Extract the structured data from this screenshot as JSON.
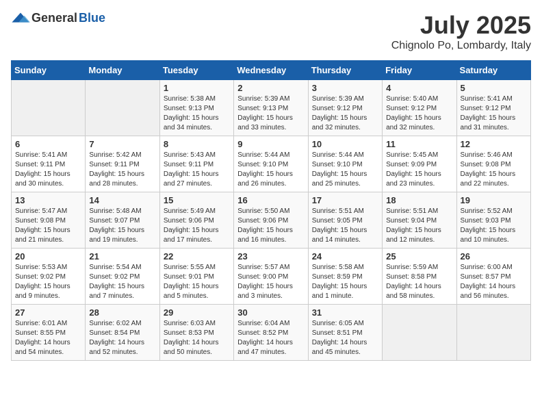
{
  "logo": {
    "general": "General",
    "blue": "Blue"
  },
  "title": "July 2025",
  "subtitle": "Chignolo Po, Lombardy, Italy",
  "headers": [
    "Sunday",
    "Monday",
    "Tuesday",
    "Wednesday",
    "Thursday",
    "Friday",
    "Saturday"
  ],
  "weeks": [
    [
      {
        "day": "",
        "info": ""
      },
      {
        "day": "",
        "info": ""
      },
      {
        "day": "1",
        "info": "Sunrise: 5:38 AM\nSunset: 9:13 PM\nDaylight: 15 hours\nand 34 minutes."
      },
      {
        "day": "2",
        "info": "Sunrise: 5:39 AM\nSunset: 9:13 PM\nDaylight: 15 hours\nand 33 minutes."
      },
      {
        "day": "3",
        "info": "Sunrise: 5:39 AM\nSunset: 9:12 PM\nDaylight: 15 hours\nand 32 minutes."
      },
      {
        "day": "4",
        "info": "Sunrise: 5:40 AM\nSunset: 9:12 PM\nDaylight: 15 hours\nand 32 minutes."
      },
      {
        "day": "5",
        "info": "Sunrise: 5:41 AM\nSunset: 9:12 PM\nDaylight: 15 hours\nand 31 minutes."
      }
    ],
    [
      {
        "day": "6",
        "info": "Sunrise: 5:41 AM\nSunset: 9:11 PM\nDaylight: 15 hours\nand 30 minutes."
      },
      {
        "day": "7",
        "info": "Sunrise: 5:42 AM\nSunset: 9:11 PM\nDaylight: 15 hours\nand 28 minutes."
      },
      {
        "day": "8",
        "info": "Sunrise: 5:43 AM\nSunset: 9:11 PM\nDaylight: 15 hours\nand 27 minutes."
      },
      {
        "day": "9",
        "info": "Sunrise: 5:44 AM\nSunset: 9:10 PM\nDaylight: 15 hours\nand 26 minutes."
      },
      {
        "day": "10",
        "info": "Sunrise: 5:44 AM\nSunset: 9:10 PM\nDaylight: 15 hours\nand 25 minutes."
      },
      {
        "day": "11",
        "info": "Sunrise: 5:45 AM\nSunset: 9:09 PM\nDaylight: 15 hours\nand 23 minutes."
      },
      {
        "day": "12",
        "info": "Sunrise: 5:46 AM\nSunset: 9:08 PM\nDaylight: 15 hours\nand 22 minutes."
      }
    ],
    [
      {
        "day": "13",
        "info": "Sunrise: 5:47 AM\nSunset: 9:08 PM\nDaylight: 15 hours\nand 21 minutes."
      },
      {
        "day": "14",
        "info": "Sunrise: 5:48 AM\nSunset: 9:07 PM\nDaylight: 15 hours\nand 19 minutes."
      },
      {
        "day": "15",
        "info": "Sunrise: 5:49 AM\nSunset: 9:06 PM\nDaylight: 15 hours\nand 17 minutes."
      },
      {
        "day": "16",
        "info": "Sunrise: 5:50 AM\nSunset: 9:06 PM\nDaylight: 15 hours\nand 16 minutes."
      },
      {
        "day": "17",
        "info": "Sunrise: 5:51 AM\nSunset: 9:05 PM\nDaylight: 15 hours\nand 14 minutes."
      },
      {
        "day": "18",
        "info": "Sunrise: 5:51 AM\nSunset: 9:04 PM\nDaylight: 15 hours\nand 12 minutes."
      },
      {
        "day": "19",
        "info": "Sunrise: 5:52 AM\nSunset: 9:03 PM\nDaylight: 15 hours\nand 10 minutes."
      }
    ],
    [
      {
        "day": "20",
        "info": "Sunrise: 5:53 AM\nSunset: 9:02 PM\nDaylight: 15 hours\nand 9 minutes."
      },
      {
        "day": "21",
        "info": "Sunrise: 5:54 AM\nSunset: 9:02 PM\nDaylight: 15 hours\nand 7 minutes."
      },
      {
        "day": "22",
        "info": "Sunrise: 5:55 AM\nSunset: 9:01 PM\nDaylight: 15 hours\nand 5 minutes."
      },
      {
        "day": "23",
        "info": "Sunrise: 5:57 AM\nSunset: 9:00 PM\nDaylight: 15 hours\nand 3 minutes."
      },
      {
        "day": "24",
        "info": "Sunrise: 5:58 AM\nSunset: 8:59 PM\nDaylight: 15 hours\nand 1 minute."
      },
      {
        "day": "25",
        "info": "Sunrise: 5:59 AM\nSunset: 8:58 PM\nDaylight: 14 hours\nand 58 minutes."
      },
      {
        "day": "26",
        "info": "Sunrise: 6:00 AM\nSunset: 8:57 PM\nDaylight: 14 hours\nand 56 minutes."
      }
    ],
    [
      {
        "day": "27",
        "info": "Sunrise: 6:01 AM\nSunset: 8:55 PM\nDaylight: 14 hours\nand 54 minutes."
      },
      {
        "day": "28",
        "info": "Sunrise: 6:02 AM\nSunset: 8:54 PM\nDaylight: 14 hours\nand 52 minutes."
      },
      {
        "day": "29",
        "info": "Sunrise: 6:03 AM\nSunset: 8:53 PM\nDaylight: 14 hours\nand 50 minutes."
      },
      {
        "day": "30",
        "info": "Sunrise: 6:04 AM\nSunset: 8:52 PM\nDaylight: 14 hours\nand 47 minutes."
      },
      {
        "day": "31",
        "info": "Sunrise: 6:05 AM\nSunset: 8:51 PM\nDaylight: 14 hours\nand 45 minutes."
      },
      {
        "day": "",
        "info": ""
      },
      {
        "day": "",
        "info": ""
      }
    ]
  ]
}
